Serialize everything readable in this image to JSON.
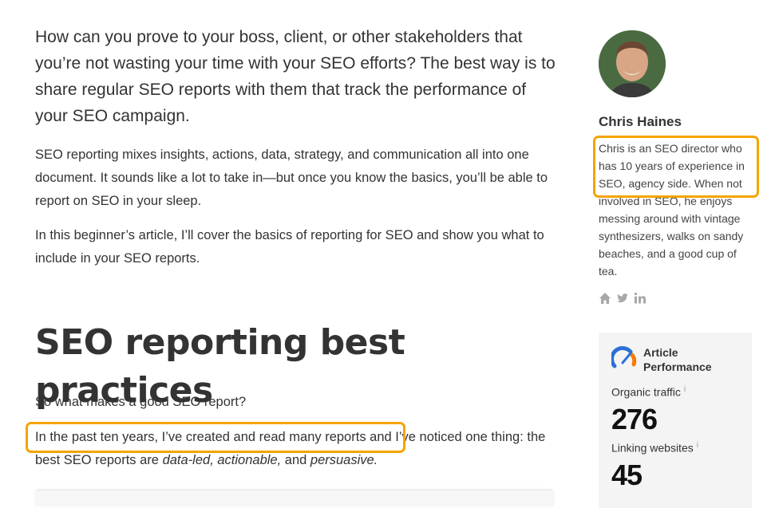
{
  "article": {
    "intro": "How can you prove to your boss, client, or other stakeholders that you’re not wasting your time with your SEO efforts? The best way is to share regular SEO reports with them that track the performance of your SEO campaign.",
    "para1": "SEO reporting mixes insights, actions, data, strategy, and communication all into one document. It sounds like a lot to take in—but once you know the basics, you’ll be able to report on SEO in your sleep.",
    "para2": "In this beginner’s article, I’ll cover the basics of reporting for SEO and show you what to include in your SEO reports.",
    "heading": "SEO reporting best practices",
    "para3": "So what makes a good SEO report?",
    "para4_part1": "In the past ten years, I’ve created and read many reports",
    "para4_part2": " and I’ve noticed one thing: the best SEO reports are ",
    "para4_em1": "data-led, actionable,",
    "para4_part3": " and ",
    "para4_em2": "persuasive.",
    "highlight_color": "#f5a400"
  },
  "author": {
    "name": "Chris Haines",
    "bio": "Chris is an SEO director who has 10 years of experience in SEO, agency side. When not involved in SEO, he enjoys messing around with vintage synthesizers, walks on sandy beaches, and a good cup of tea.",
    "socials": [
      "home-icon",
      "twitter-icon",
      "linkedin-icon"
    ]
  },
  "performance": {
    "title": "Article Performance",
    "organic_label": "Organic traffic",
    "organic_value": "276",
    "linking_label": "Linking websites",
    "linking_value": "45",
    "info_glyph": "i"
  }
}
